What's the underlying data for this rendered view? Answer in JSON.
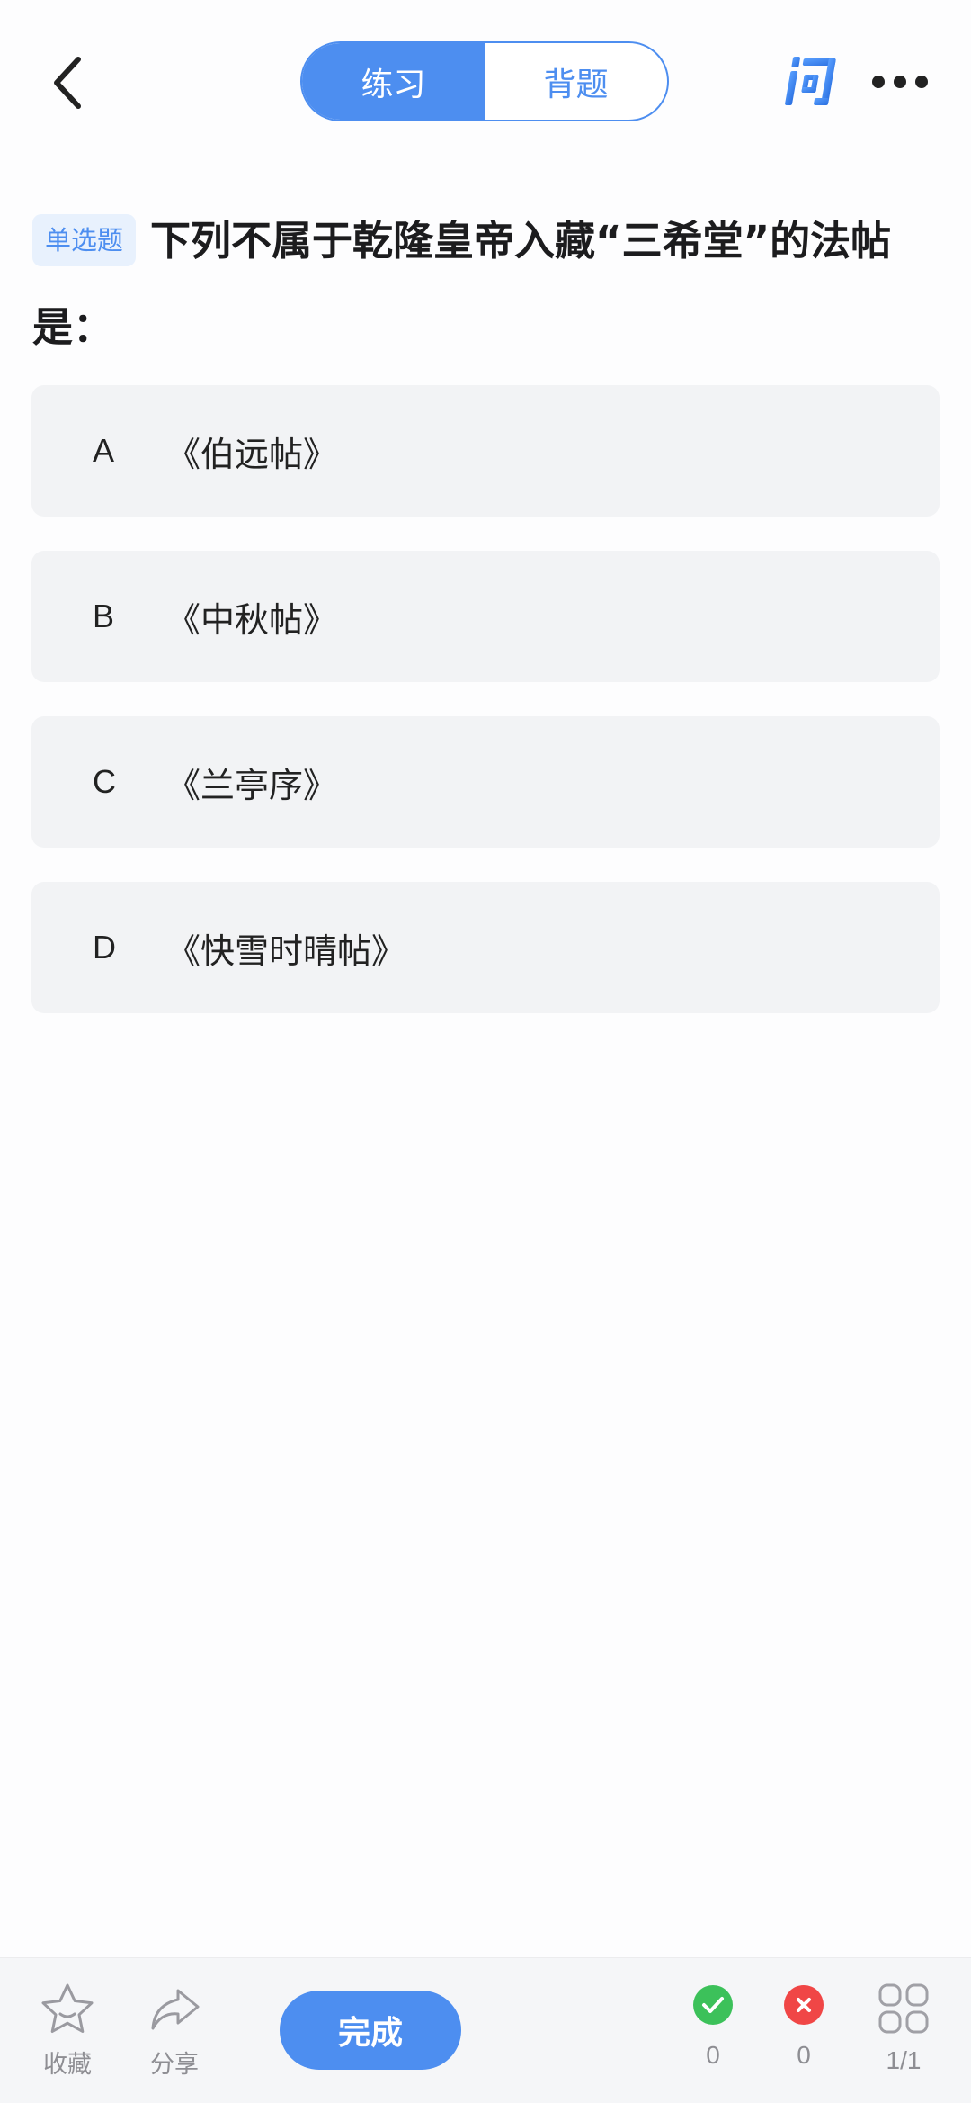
{
  "header": {
    "tabs": [
      {
        "label": "练习",
        "active": true
      },
      {
        "label": "背题",
        "active": false
      }
    ],
    "ask_icon_glyph": "问",
    "icons": [
      "back-arrow-icon",
      "ask-icon",
      "more-icon"
    ]
  },
  "question": {
    "type_label": "单选题",
    "text": "下列不属于乾隆皇帝入藏“三希堂”的法帖是："
  },
  "options": [
    {
      "letter": "A",
      "text": "《伯远帖》"
    },
    {
      "letter": "B",
      "text": "《中秋帖》"
    },
    {
      "letter": "C",
      "text": "《兰亭序》"
    },
    {
      "letter": "D",
      "text": "《快雪时晴帖》"
    }
  ],
  "footer": {
    "favorite_label": "收藏",
    "share_label": "分享",
    "done_label": "完成",
    "correct_count": "0",
    "wrong_count": "0",
    "progress": "1/1"
  },
  "colors": {
    "accent": "#4d8ef0",
    "correct": "#3cc15a",
    "wrong": "#f04646",
    "option_bg": "#f2f3f5"
  }
}
